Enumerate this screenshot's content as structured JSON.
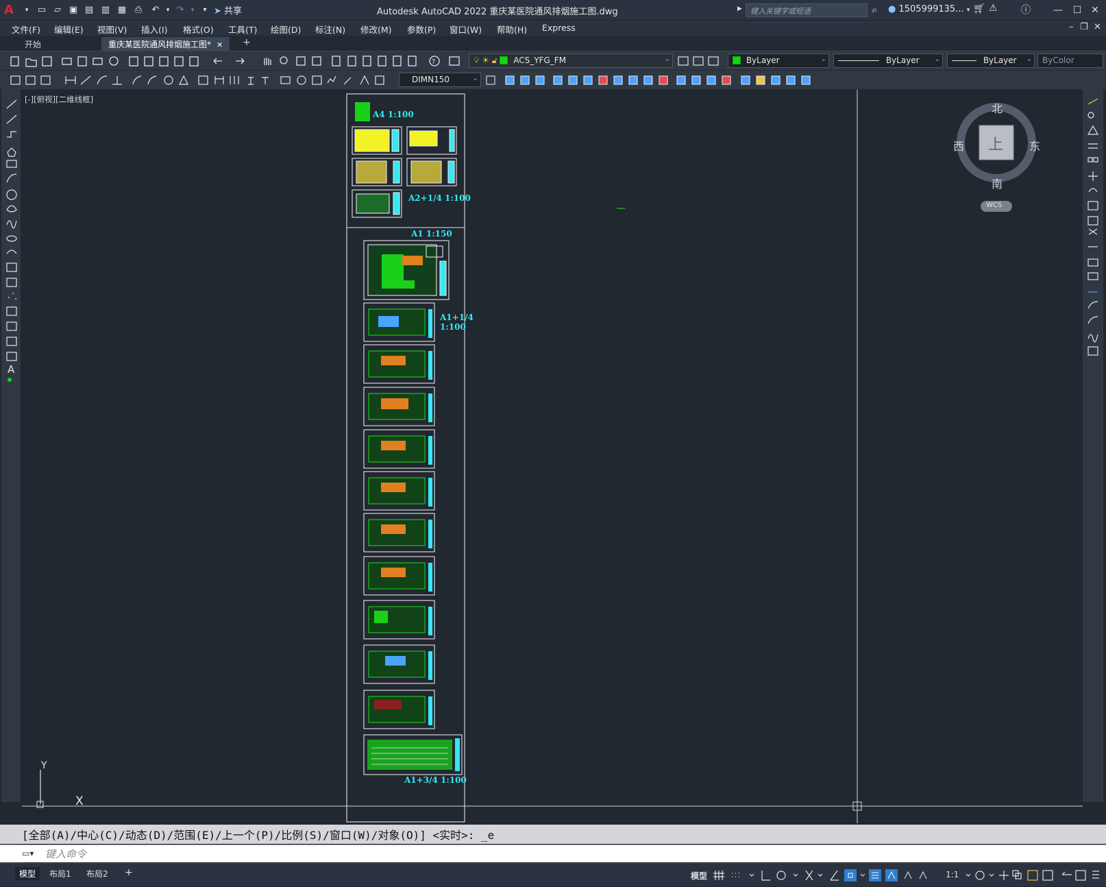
{
  "app": {
    "title": "Autodesk AutoCAD 2022    重庆某医院通风排烟施工图.dwg",
    "share_label": "共享",
    "search_placeholder": "键入关键字或短语",
    "user": "1505999135...",
    "logo": "A"
  },
  "menu": [
    "文件(F)",
    "编辑(E)",
    "视图(V)",
    "插入(I)",
    "格式(O)",
    "工具(T)",
    "绘图(D)",
    "标注(N)",
    "修改(M)",
    "参数(P)",
    "窗口(W)",
    "帮助(H)",
    "Express"
  ],
  "tabs": [
    {
      "label": "开始",
      "active": false
    },
    {
      "label": "重庆某医院通风排烟施工图*",
      "active": true
    }
  ],
  "tab_add": "+",
  "toolbar": {
    "layer": "ACS_YFG_FM",
    "color": "ByLayer",
    "linetype": "ByLayer",
    "lineweight": "ByLayer",
    "plotstyle": "ByColor",
    "dimstyle": "DIMN150"
  },
  "viewport": {
    "label": "[-][俯视][二维线框]",
    "ucs_x": "X",
    "ucs_y": "Y"
  },
  "viewcube": {
    "north": "北",
    "south": "南",
    "east": "东",
    "west": "西",
    "face": "上",
    "wcs": "WCS"
  },
  "sheets": {
    "label_a4": "A4 1:100",
    "label_a2": "A2+1/4  1:100",
    "label_a1": "A1  1:150",
    "label_a1q_line1": "A1+1/4",
    "label_a1q_line2": "1:100",
    "label_a1_3q": "A1+3/4  1:100"
  },
  "command": {
    "history": "[全部(A)/中心(C)/动态(D)/范围(E)/上一个(P)/比例(S)/窗口(W)/对象(O)] <实时>: _e",
    "placeholder": "键入命令"
  },
  "layout_tabs": [
    "模型",
    "布局1",
    "布局2"
  ],
  "layout_add": "+",
  "status": {
    "model": "模型",
    "scale": "1:1"
  },
  "colors": {
    "drawing_bg": "#212830",
    "accent_green": "#19d119",
    "label_cyan": "#35e8f2",
    "sheet_yellow": "#f2f224"
  }
}
